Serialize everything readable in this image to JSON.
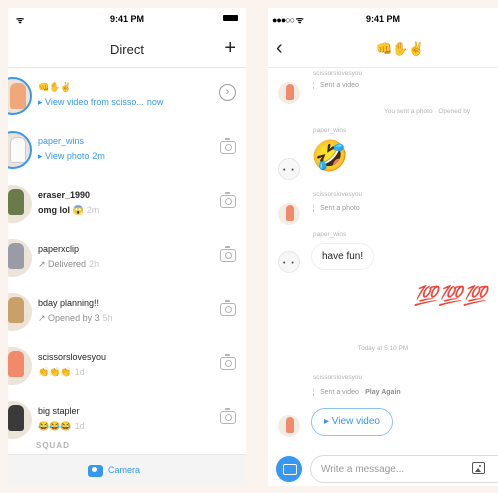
{
  "status_bar": {
    "time": "9:41 PM"
  },
  "inbox": {
    "title": "Direct",
    "add_label": "+",
    "conversations": [
      {
        "name": "👊✋✌️",
        "subtitle": "▸ View video from scisso...",
        "time": "now",
        "name_style": "bold",
        "subtitle_style": "blue",
        "action_icon": "chevron-right-circle-icon"
      },
      {
        "name": "paper_wins",
        "subtitle": "▸ View photo",
        "time": "2m",
        "name_style": "blue",
        "subtitle_style": "blue",
        "action_icon": "camera-icon"
      },
      {
        "name": "eraser_1990",
        "subtitle": "omg lol 😱",
        "time": "2m",
        "name_style": "bold",
        "subtitle_style": "bold",
        "action_icon": "camera-icon"
      },
      {
        "name": "paperxclip",
        "subtitle": "↗ Delivered",
        "time": "2h",
        "name_style": "normal",
        "subtitle_style": "gray",
        "action_icon": "camera-icon"
      },
      {
        "name": "bday planning!!",
        "subtitle": "↗ Opened by 3",
        "time": "5h",
        "name_style": "normal",
        "subtitle_style": "gray",
        "action_icon": "camera-icon"
      },
      {
        "name": "scissorslovesyou",
        "subtitle": "👏👏👏",
        "time": "1d",
        "name_style": "normal",
        "subtitle_style": "normal",
        "action_icon": "camera-icon"
      },
      {
        "name": "big stapler",
        "subtitle": "😂😂😂",
        "time": "1d",
        "name_style": "normal",
        "subtitle_style": "normal",
        "action_icon": "camera-icon"
      }
    ],
    "cut_off_row": "SQUAD",
    "camera_label": "Camera"
  },
  "thread": {
    "title": "👊✋✌️",
    "messages": {
      "sender_1": "scissorslovesyou",
      "note_1": "Sent a video",
      "sent_note": "You sent a photo · Opened by",
      "sender_2": "paper_wins",
      "emoji_1": "🤣",
      "sender_3": "scissorslovesyou",
      "note_2": "Sent a photo",
      "sender_4": "paper_wins",
      "bubble_1": "have fun!",
      "hundred": "💯💯💯",
      "divider": "Today at 5:10 PM",
      "sender_5": "scissorslovesyou",
      "note_3_prefix": "Sent a video · ",
      "note_3_action": "Play Again",
      "view_video": "▸ View video"
    },
    "composer": {
      "placeholder": "Write a message..."
    }
  },
  "colors": {
    "accent_blue": "#3897f0",
    "background": "#fbf3ee",
    "hundred_red": "#d0021b"
  }
}
